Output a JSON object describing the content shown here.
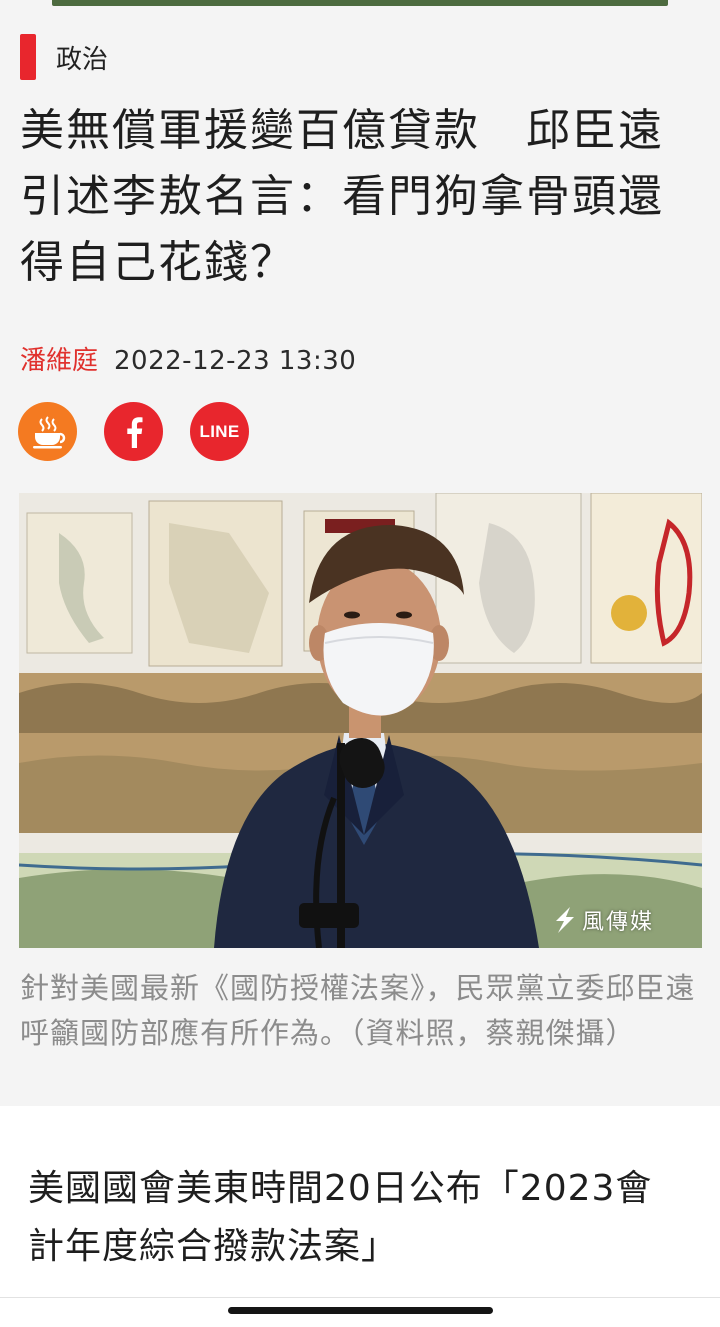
{
  "article": {
    "category": "政治",
    "headline": "美無償軍援變百億貸款　邱臣遠引述李敖名言：看門狗拿骨頭還得自己花錢？",
    "author": "潘維庭",
    "datetime": "2022-12-23 13:30",
    "photo": {
      "watermark": "風傳媒",
      "caption": "針對美國最新《國防授權法案》，民眾黨立委邱臣遠呼籲國防部應有所作為。（資料照，蔡親傑攝）"
    },
    "body_text": "美國國會美東時間20日公布「2023會計年度綜合撥款法案」"
  },
  "share": {
    "line_label": "LINE"
  },
  "colors": {
    "accent_red": "#e8262d",
    "coffee_orange": "#f47a21",
    "author_red": "#e0312d",
    "caption_gray": "#8c8c8c"
  },
  "icons": [
    "coffee-icon",
    "facebook-icon",
    "line-icon",
    "watermark-logo-icon"
  ]
}
